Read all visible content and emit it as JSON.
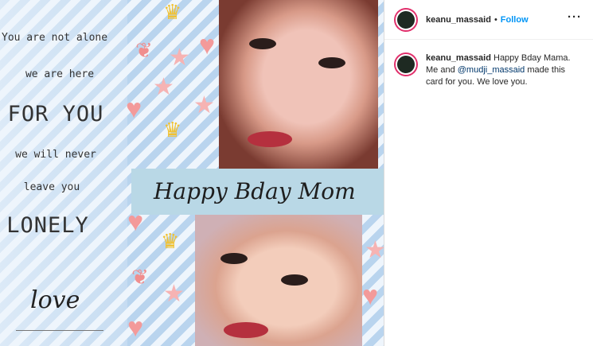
{
  "image": {
    "poem": {
      "line1": "You are not alone",
      "line2": "we are here",
      "line3": "FOR YOU",
      "line4": "we will never",
      "line5": "leave you",
      "line6": "LONELY",
      "line7": "love"
    },
    "banner_text": "Happy Bday Mom",
    "colors": {
      "stripe": "#b9d4ee",
      "banner": "#b9d8e6",
      "heart": "#f39a9a",
      "crown": "#f1c232"
    }
  },
  "post": {
    "username": "keanu_massaid",
    "follow_label": "Follow",
    "more_icon": "more-options-icon",
    "caption_username": "keanu_massaid",
    "caption_part1": "Happy Bday Mama. Me and ",
    "caption_mention": "@mudji_massaid",
    "caption_part2": " made this card for you. We love you."
  },
  "colors": {
    "link": "#0095f6",
    "mention": "#00376b",
    "avatar_ring": "#e1306c"
  }
}
